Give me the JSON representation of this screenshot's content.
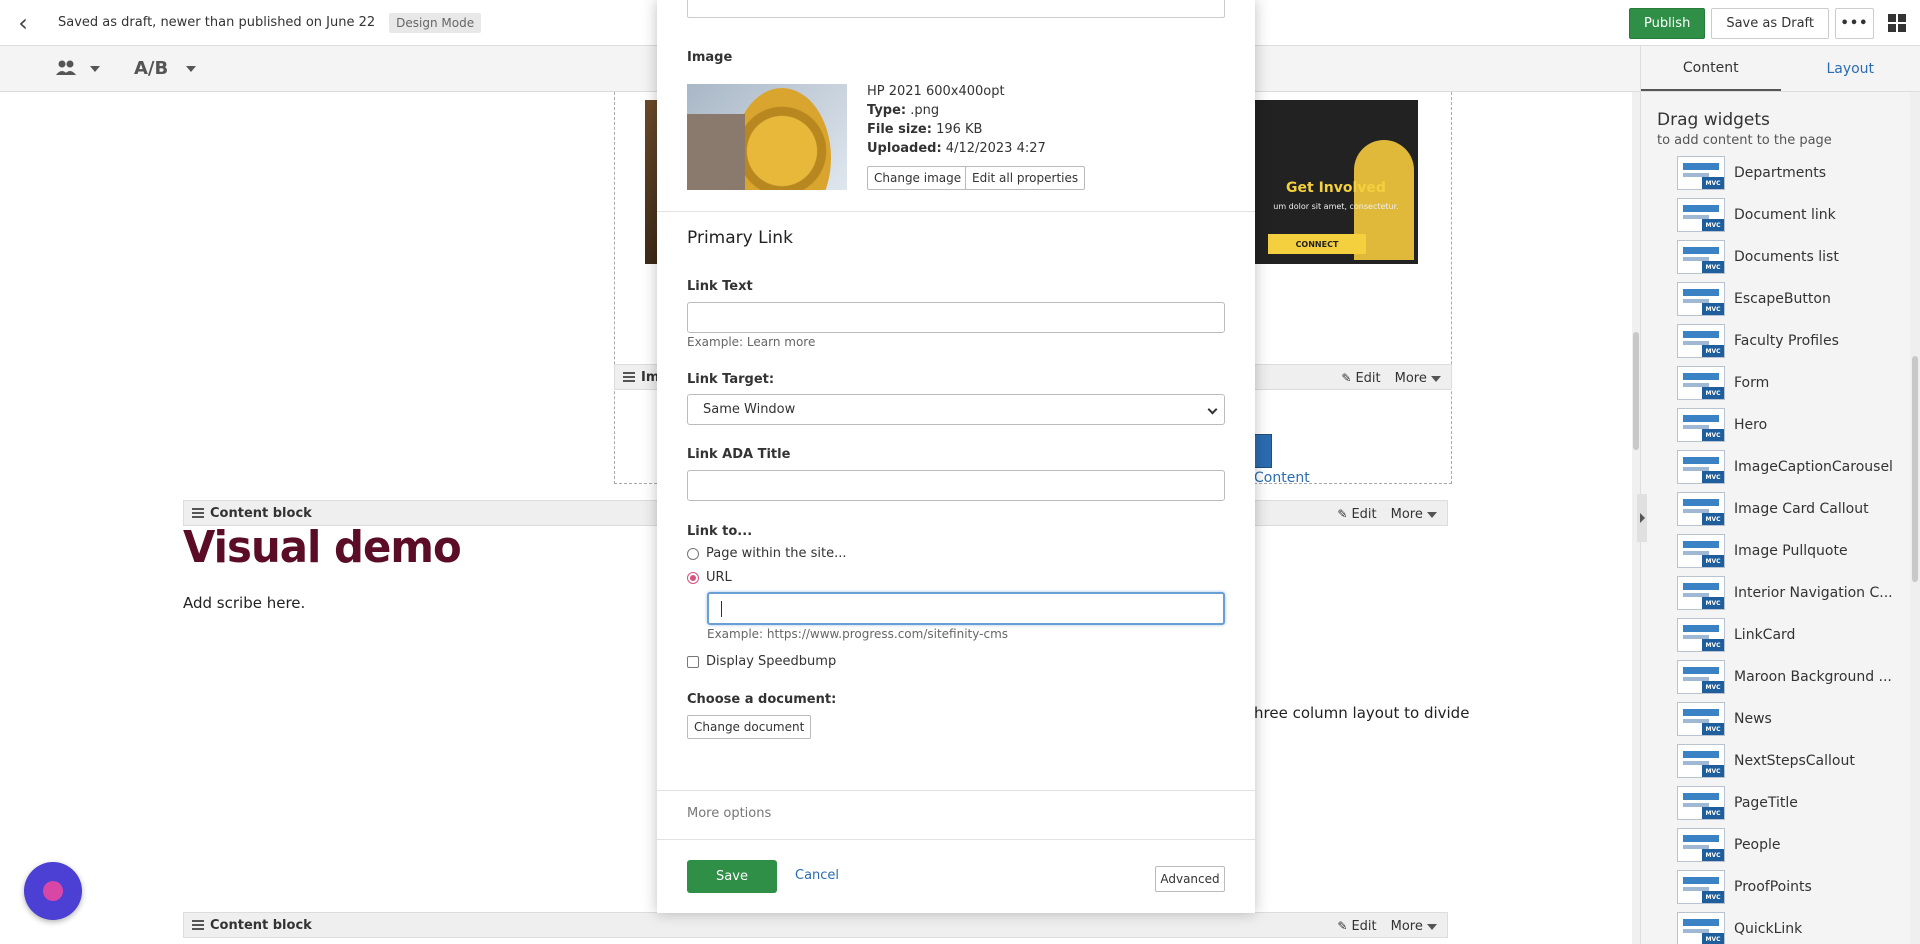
{
  "topbar": {
    "status": "Saved as draft, newer than published on June 22",
    "mode": "Design Mode",
    "publish": "Publish",
    "save_draft": "Save as Draft",
    "more": "•••"
  },
  "toolbar": {
    "ab_label": "A/B"
  },
  "canvas": {
    "widget_bars": [
      {
        "label": "Im",
        "edit": "Edit",
        "more": "More"
      },
      {
        "label": "Content block",
        "edit": "Edit",
        "more": "More"
      },
      {
        "label": "Content block",
        "edit": "Edit",
        "more": "More"
      }
    ],
    "heading": "Visual demo",
    "scribe": "Add scribe here.",
    "three_col_text": "hree column layout to divide",
    "content_link": "Content",
    "promo": {
      "title": "Get Involved",
      "body": "um dolor sit amet, consectetur.",
      "button": "CONNECT"
    }
  },
  "panel": {
    "tabs": [
      "Content",
      "Layout"
    ],
    "drag_title": "Drag widgets",
    "drag_subtitle": "to add content to the page",
    "mvc_badge": "MVC",
    "widgets": [
      "Departments",
      "Document link",
      "Documents list",
      "EscapeButton",
      "Faculty Profiles",
      "Form",
      "Hero",
      "ImageCaptionCarousel",
      "Image Card Callout",
      "Image Pullquote",
      "Interior Navigation C...",
      "LinkCard",
      "Maroon Background ...",
      "News",
      "NextStepsCallout",
      "PageTitle",
      "People",
      "ProofPoints",
      "QuickLink"
    ]
  },
  "modal": {
    "image_label": "Image",
    "image": {
      "name": "HP 2021 600x400opt",
      "type_label": "Type:",
      "type": ".png",
      "size_label": "File size:",
      "size": "196 KB",
      "uploaded_label": "Uploaded:",
      "uploaded": "4/12/2023 4:27"
    },
    "change_image": "Change image",
    "edit_all": "Edit all properties",
    "primary_link": "Primary Link",
    "link_text_label": "Link Text",
    "link_text_value": "",
    "link_text_hint": "Example: Learn more",
    "link_target_label": "Link Target:",
    "link_target_value": "Same Window",
    "ada_title_label": "Link ADA Title",
    "ada_title_value": "",
    "link_to_label": "Link to...",
    "radio_page": "Page within the site...",
    "radio_url": "URL",
    "url_value": "",
    "url_hint": "Example: https://www.progress.com/sitefinity-cms",
    "speedbump": "Display Speedbump",
    "choose_doc": "Choose a document:",
    "change_doc": "Change document",
    "more_options": "More options",
    "save": "Save",
    "cancel": "Cancel",
    "advanced": "Advanced"
  },
  "colors": {
    "publish_green": "#2f8f46",
    "link_blue": "#2b6cb0",
    "heading_maroon": "#5b0d27",
    "radio_pink": "#d4537f"
  }
}
